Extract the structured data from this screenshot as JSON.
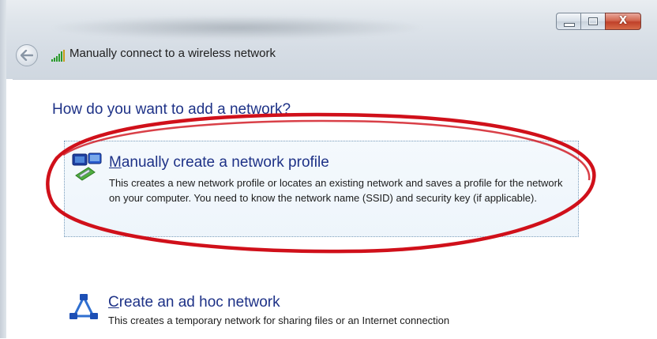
{
  "window": {
    "title": "Manually connect to a wireless network",
    "caption_buttons": [
      "minimize",
      "maximize",
      "close"
    ],
    "close_glyph": "X"
  },
  "main": {
    "question": "How do you want to add a network?",
    "options": [
      {
        "title_accel": "M",
        "title_rest": "anually create a network profile",
        "description": "This creates a new network profile or locates an existing network and saves a profile for the network on your computer. You need to know the network name (SSID) and security key (if applicable).",
        "icon": "network-profile-icon",
        "highlighted": true
      },
      {
        "title_accel": "C",
        "title_rest": "reate an ad hoc network",
        "description": "This creates a temporary network for sharing files or an Internet connection",
        "icon": "ad-hoc-network-icon",
        "highlighted": false
      }
    ]
  },
  "annotation": {
    "shape": "ellipse",
    "color": "#d0101a"
  },
  "colors": {
    "heading_blue": "#1e3287",
    "close_red": "#c0412a"
  }
}
